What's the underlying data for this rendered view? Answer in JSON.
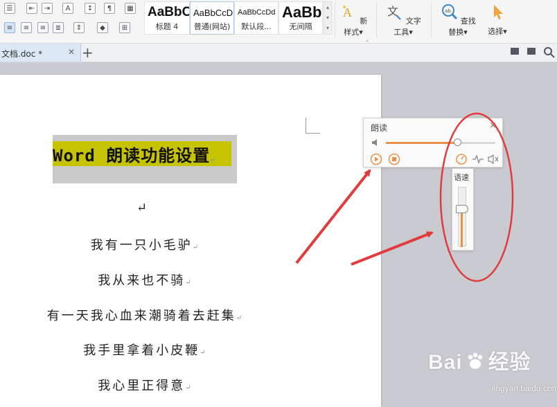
{
  "ribbon": {
    "styles": [
      {
        "sample": "AaBbC",
        "name": "标题 4"
      },
      {
        "sample": "AaBbCcD",
        "name": "普通(网站)"
      },
      {
        "sample": "AaBbCcDd",
        "name": "默认段..."
      },
      {
        "sample": "AaBb",
        "name": "无间隔"
      }
    ],
    "new_style_label": "新样式",
    "text_tools_label": "文字工具",
    "find_replace_label": "查找替换",
    "select_label": "选择",
    "dropdown_glyph": "▾"
  },
  "tabs": {
    "doc_tab_label": "文档.doc *",
    "close_glyph": "✕",
    "add_glyph": "+"
  },
  "document": {
    "title": "Word 朗读功能设置",
    "return_mark": "↵",
    "lines": [
      "我有一只小毛驴",
      "我从来也不骑",
      "有一天我心血来潮骑着去赶集",
      "我手里拿着小皮鞭",
      "我心里正得意"
    ]
  },
  "read_panel": {
    "title": "朗读",
    "close_glyph": "×",
    "volume_level": 0.65,
    "speed_label": "语速",
    "speed_level": 0.7
  },
  "watermark": {
    "brand": "Bai",
    "brand2": "经验",
    "url": "jingyan.baidu.com"
  },
  "colors": {
    "accent_orange": "#e8914a",
    "highlight_yellow": "#c6c400",
    "annotation_red": "#e23b3b"
  }
}
